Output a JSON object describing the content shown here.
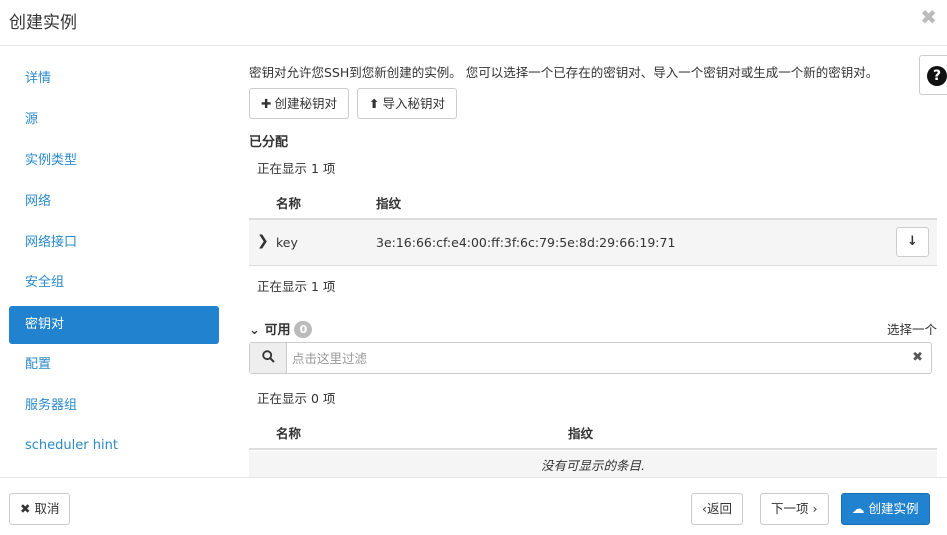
{
  "dialog": {
    "title": "创建实例",
    "close_icon": "✖"
  },
  "sidebar": {
    "items": [
      {
        "label": "详情"
      },
      {
        "label": "源"
      },
      {
        "label": "实例类型"
      },
      {
        "label": "网络"
      },
      {
        "label": "网络接口"
      },
      {
        "label": "安全组"
      },
      {
        "label": "密钥对",
        "active": true
      },
      {
        "label": "配置"
      },
      {
        "label": "服务器组"
      },
      {
        "label": "scheduler hint"
      }
    ]
  },
  "help": {
    "label": "?"
  },
  "main": {
    "intro": "密钥对允许您SSH到您新创建的实例。 您可以选择一个已存在的密钥对、导入一个密钥对或生成一个新的密钥对。",
    "create_keypair_label": "创建秘钥对",
    "create_keypair_icon": "plus-icon",
    "import_keypair_label": "导入秘钥对",
    "import_keypair_icon": "upload-icon",
    "allocated": {
      "title": "已分配",
      "count_top": "正在显示 1 项",
      "count_bottom": "正在显示 1 项",
      "columns": [
        "名称",
        "指纹"
      ],
      "rows": [
        {
          "name": "key",
          "fingerprint": "3e:16:66:cf:e4:00:ff:3f:6c:79:5e:8d:29:66:19:71"
        }
      ]
    },
    "available": {
      "title": "可用",
      "badge": "0",
      "select_one": "选择一个",
      "search_placeholder": "点击这里过滤",
      "count": "正在显示 0 项",
      "columns": [
        "名称",
        "指纹"
      ],
      "empty_text": "没有可显示的条目."
    }
  },
  "footer": {
    "cancel_label": "取消",
    "back_label": "返回",
    "next_label": "下一项",
    "launch_label": "创建实例"
  },
  "colors": {
    "accent": "#2183cf",
    "link": "#2a8ac8"
  }
}
